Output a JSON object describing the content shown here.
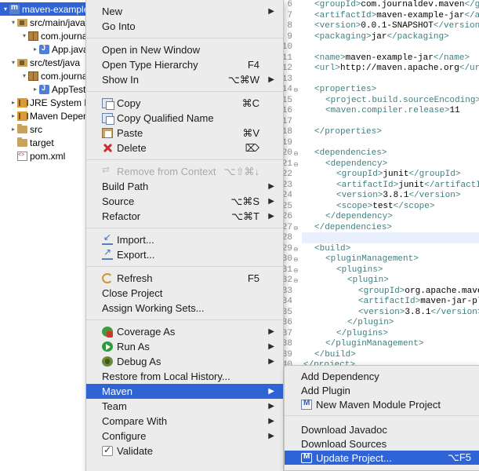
{
  "project_tree": [
    {
      "label": "maven-example-jar",
      "indent": 0,
      "twisty": "▾",
      "icon": "project-icon",
      "selected": true
    },
    {
      "label": "src/main/java",
      "indent": 1,
      "twisty": "▾",
      "icon": "source-folder-icon"
    },
    {
      "label": "com.journaldev",
      "indent": 2,
      "twisty": "▾",
      "icon": "package-icon"
    },
    {
      "label": "App.java",
      "indent": 3,
      "twisty": "▸",
      "icon": "java-file-icon"
    },
    {
      "label": "src/test/java",
      "indent": 1,
      "twisty": "▾",
      "icon": "source-folder-icon"
    },
    {
      "label": "com.journaldev",
      "indent": 2,
      "twisty": "▾",
      "icon": "package-icon"
    },
    {
      "label": "AppTest.java",
      "indent": 3,
      "twisty": "▸",
      "icon": "java-file-icon"
    },
    {
      "label": "JRE System Library",
      "indent": 1,
      "twisty": "▸",
      "icon": "library-icon"
    },
    {
      "label": "Maven Dependencies",
      "indent": 1,
      "twisty": "▸",
      "icon": "library-icon"
    },
    {
      "label": "src",
      "indent": 1,
      "twisty": "▸",
      "icon": "folder-icon"
    },
    {
      "label": "target",
      "indent": 1,
      "twisty": "",
      "icon": "folder-icon"
    },
    {
      "label": "pom.xml",
      "indent": 1,
      "twisty": "",
      "icon": "xml-file-icon"
    }
  ],
  "context_menu": {
    "items": [
      {
        "label": "New",
        "shortcut": "",
        "submenu": true
      },
      {
        "label": "Go Into",
        "shortcut": ""
      },
      {
        "separator": true
      },
      {
        "label": "Open in New Window",
        "shortcut": ""
      },
      {
        "label": "Open Type Hierarchy",
        "shortcut": "F4"
      },
      {
        "label": "Show In",
        "shortcut": "⌥⌘W",
        "submenu": true
      },
      {
        "separator": true
      },
      {
        "label": "Copy",
        "shortcut": "⌘C",
        "icon": "copy-icon"
      },
      {
        "label": "Copy Qualified Name",
        "shortcut": "",
        "icon": "copy-qualified-name-icon"
      },
      {
        "label": "Paste",
        "shortcut": "⌘V",
        "icon": "paste-icon"
      },
      {
        "label": "Delete",
        "shortcut": "⌦",
        "icon": "delete-icon"
      },
      {
        "separator": true
      },
      {
        "label": "Remove from Context",
        "shortcut": "⌥⇧⌘↓",
        "icon": "remove-context-icon",
        "disabled": true
      },
      {
        "label": "Build Path",
        "shortcut": "",
        "submenu": true
      },
      {
        "label": "Source",
        "shortcut": "⌥⌘S",
        "submenu": true
      },
      {
        "label": "Refactor",
        "shortcut": "⌥⌘T",
        "submenu": true
      },
      {
        "separator": true
      },
      {
        "label": "Import...",
        "shortcut": "",
        "icon": "import-icon"
      },
      {
        "label": "Export...",
        "shortcut": "",
        "icon": "export-icon"
      },
      {
        "separator": true
      },
      {
        "label": "Refresh",
        "shortcut": "F5",
        "icon": "refresh-icon"
      },
      {
        "label": "Close Project",
        "shortcut": ""
      },
      {
        "label": "Assign Working Sets...",
        "shortcut": ""
      },
      {
        "separator": true
      },
      {
        "label": "Coverage As",
        "shortcut": "",
        "icon": "coverage-icon",
        "submenu": true
      },
      {
        "label": "Run As",
        "shortcut": "",
        "icon": "run-icon",
        "submenu": true
      },
      {
        "label": "Debug As",
        "shortcut": "",
        "icon": "debug-icon",
        "submenu": true
      },
      {
        "label": "Restore from Local History...",
        "shortcut": ""
      },
      {
        "label": "Maven",
        "shortcut": "",
        "submenu": true,
        "active": true
      },
      {
        "label": "Team",
        "shortcut": "",
        "submenu": true
      },
      {
        "label": "Compare With",
        "shortcut": "",
        "submenu": true
      },
      {
        "label": "Configure",
        "shortcut": "",
        "submenu": true
      },
      {
        "label": "Validate",
        "shortcut": "",
        "icon": "validate-check-icon"
      }
    ]
  },
  "maven_submenu": {
    "items": [
      {
        "label": "Add Dependency",
        "shortcut": ""
      },
      {
        "label": "Add Plugin",
        "shortcut": ""
      },
      {
        "label": "New Maven Module Project",
        "shortcut": "",
        "icon": "maven-module-icon"
      },
      {
        "separator": true
      },
      {
        "label": "Download Javadoc",
        "shortcut": ""
      },
      {
        "label": "Download Sources",
        "shortcut": ""
      },
      {
        "label": "Update Project...",
        "shortcut": "⌥F5",
        "icon": "update-project-icon",
        "active": true
      }
    ]
  },
  "editor": {
    "lines": [
      {
        "num": "6",
        "fold": "",
        "indent": 2,
        "segments": [
          [
            "tg",
            "<groupId>"
          ],
          [
            "tx",
            "com.journaldev.maven"
          ],
          [
            "tg",
            "</groupId>"
          ]
        ]
      },
      {
        "num": "7",
        "fold": "",
        "indent": 2,
        "segments": [
          [
            "tg",
            "<artifactId>"
          ],
          [
            "tx",
            "maven-example-jar"
          ],
          [
            "tg",
            "</artifactId>"
          ]
        ]
      },
      {
        "num": "8",
        "fold": "",
        "indent": 2,
        "segments": [
          [
            "tg",
            "<version>"
          ],
          [
            "tx",
            "0.0.1-SNAPSHOT"
          ],
          [
            "tg",
            "</version>"
          ]
        ]
      },
      {
        "num": "9",
        "fold": "",
        "indent": 2,
        "segments": [
          [
            "tg",
            "<packaging>"
          ],
          [
            "tx",
            "jar"
          ],
          [
            "tg",
            "</packaging>"
          ]
        ]
      },
      {
        "num": "10",
        "fold": "",
        "indent": 0,
        "segments": []
      },
      {
        "num": "11",
        "fold": "",
        "indent": 2,
        "segments": [
          [
            "tg",
            "<name>"
          ],
          [
            "tx",
            "maven-example-jar"
          ],
          [
            "tg",
            "</name>"
          ]
        ]
      },
      {
        "num": "12",
        "fold": "",
        "indent": 2,
        "segments": [
          [
            "tg",
            "<url>"
          ],
          [
            "tx",
            "http://maven.apache.org"
          ],
          [
            "tg",
            "</url>"
          ]
        ]
      },
      {
        "num": "13",
        "fold": "",
        "indent": 0,
        "segments": []
      },
      {
        "num": "14",
        "fold": "⊖",
        "indent": 2,
        "segments": [
          [
            "tg",
            "<properties>"
          ]
        ]
      },
      {
        "num": "15",
        "fold": "",
        "indent": 4,
        "segments": [
          [
            "tg",
            "<project.build.sourceEncoding>"
          ]
        ]
      },
      {
        "num": "16",
        "fold": "",
        "indent": 4,
        "segments": [
          [
            "tg",
            "<maven.compiler.release>"
          ],
          [
            "tx",
            "11"
          ]
        ]
      },
      {
        "num": "17",
        "fold": "",
        "indent": 0,
        "segments": []
      },
      {
        "num": "18",
        "fold": "",
        "indent": 2,
        "segments": [
          [
            "tg",
            "</properties>"
          ]
        ]
      },
      {
        "num": "19",
        "fold": "",
        "indent": 0,
        "segments": []
      },
      {
        "num": "20",
        "fold": "⊖",
        "indent": 2,
        "segments": [
          [
            "tg",
            "<dependencies>"
          ]
        ]
      },
      {
        "num": "21",
        "fold": "⊖",
        "indent": 4,
        "segments": [
          [
            "tg",
            "<dependency>"
          ]
        ]
      },
      {
        "num": "22",
        "fold": "",
        "indent": 6,
        "segments": [
          [
            "tg",
            "<groupId>"
          ],
          [
            "tx",
            "junit"
          ],
          [
            "tg",
            "</groupId>"
          ]
        ]
      },
      {
        "num": "23",
        "fold": "",
        "indent": 6,
        "segments": [
          [
            "tg",
            "<artifactId>"
          ],
          [
            "tx",
            "junit"
          ],
          [
            "tg",
            "</artifactId>"
          ]
        ]
      },
      {
        "num": "24",
        "fold": "",
        "indent": 6,
        "segments": [
          [
            "tg",
            "<version>"
          ],
          [
            "tx",
            "3.8.1"
          ],
          [
            "tg",
            "</version>"
          ]
        ]
      },
      {
        "num": "25",
        "fold": "",
        "indent": 6,
        "segments": [
          [
            "tg",
            "<scope>"
          ],
          [
            "tx",
            "test"
          ],
          [
            "tg",
            "</scope>"
          ]
        ]
      },
      {
        "num": "26",
        "fold": "",
        "indent": 4,
        "segments": [
          [
            "tg",
            "</dependency>"
          ]
        ]
      },
      {
        "num": "27",
        "fold": "⊖",
        "indent": 2,
        "segments": [
          [
            "tg",
            "</dependencies>"
          ]
        ]
      },
      {
        "num": "28",
        "fold": "",
        "indent": 0,
        "segments": []
      },
      {
        "num": "29",
        "fold": "⊖",
        "indent": 2,
        "segments": [
          [
            "tg",
            "<build>"
          ]
        ]
      },
      {
        "num": "30",
        "fold": "⊖",
        "indent": 4,
        "segments": [
          [
            "tg",
            "<pluginManagement>"
          ]
        ]
      },
      {
        "num": "31",
        "fold": "⊖",
        "indent": 6,
        "segments": [
          [
            "tg",
            "<plugins>"
          ]
        ]
      },
      {
        "num": "32",
        "fold": "⊖",
        "indent": 8,
        "segments": [
          [
            "tg",
            "<plugin>"
          ]
        ]
      },
      {
        "num": "33",
        "fold": "",
        "indent": 10,
        "segments": [
          [
            "tg",
            "<groupId>"
          ],
          [
            "tx",
            "org.apache.maven.plugins"
          ],
          [
            "tg",
            "</groupId>"
          ]
        ]
      },
      {
        "num": "34",
        "fold": "",
        "indent": 10,
        "segments": [
          [
            "tg",
            "<artifactId>"
          ],
          [
            "tx",
            "maven-jar-plugin"
          ],
          [
            "tg",
            "</artifactId>"
          ]
        ]
      },
      {
        "num": "35",
        "fold": "",
        "indent": 10,
        "segments": [
          [
            "tg",
            "<version>"
          ],
          [
            "tx",
            "3.8.1"
          ],
          [
            "tg",
            "</version>"
          ]
        ]
      },
      {
        "num": "36",
        "fold": "",
        "indent": 8,
        "segments": [
          [
            "tg",
            "</plugin>"
          ]
        ]
      },
      {
        "num": "37",
        "fold": "",
        "indent": 6,
        "segments": [
          [
            "tg",
            "</plugins>"
          ]
        ]
      },
      {
        "num": "38",
        "fold": "",
        "indent": 4,
        "segments": [
          [
            "tg",
            "</pluginManagement>"
          ]
        ]
      },
      {
        "num": "39",
        "fold": "",
        "indent": 2,
        "segments": [
          [
            "tg",
            "</build>"
          ]
        ]
      },
      {
        "num": "40",
        "fold": "",
        "indent": 0,
        "segments": [
          [
            "tg",
            "</project>"
          ]
        ]
      }
    ]
  }
}
